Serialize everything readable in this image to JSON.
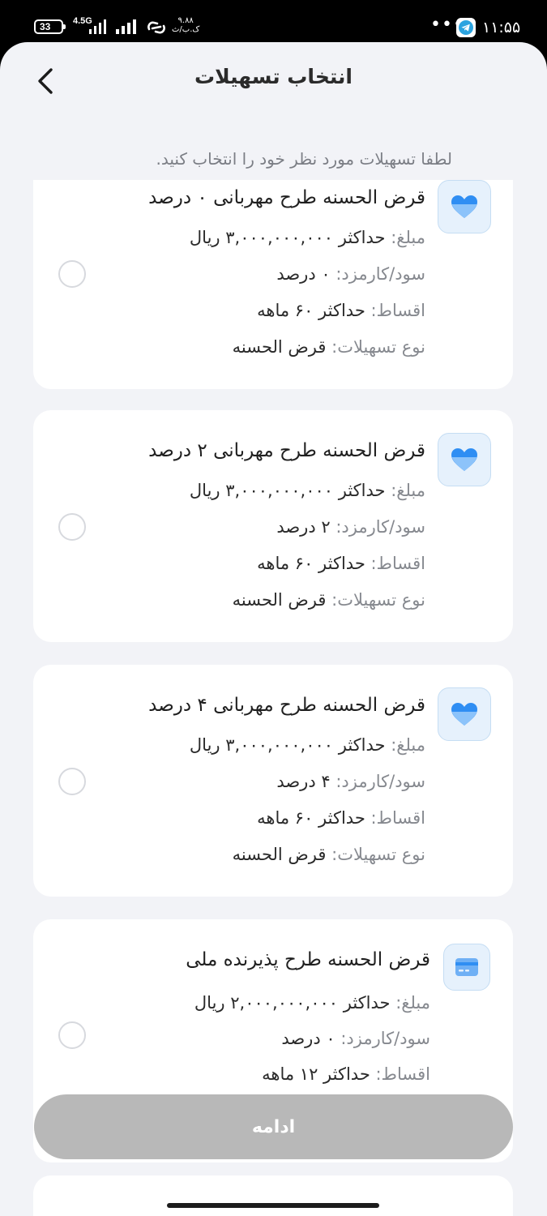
{
  "status_bar": {
    "battery": "33",
    "network": "4.5G",
    "speed_value": "۹.۸۸",
    "speed_unit": "ک.ب/ث",
    "dots": "•••",
    "time": "۱۱:۵۵",
    "icons": [
      "battery-icon",
      "signal-icon",
      "link-icon",
      "telegram-icon"
    ]
  },
  "header": {
    "title": "انتخاب تسهیلات",
    "back_icon": "chevron-left-icon"
  },
  "subtitle": "لطفا تسهیلات مورد نظر خود را انتخاب کنید.",
  "labels": {
    "amount": "مبلغ:",
    "interest": "سود/کارمزد:",
    "installments": "اقساط:",
    "type": "نوع تسهیلات:"
  },
  "cards": [
    {
      "title": "قرض الحسنه طرح مهربانی ۰ درصد",
      "icon": "heart-icon",
      "amount": "حداکثر ۳,۰۰۰,۰۰۰,۰۰۰ ریال",
      "interest": "۰ درصد",
      "installments": "حداکثر ۶۰ ماهه",
      "type": "قرض الحسنه",
      "selected": false
    },
    {
      "title": "قرض الحسنه طرح مهربانی ۲ درصد",
      "icon": "heart-icon",
      "amount": "حداکثر ۳,۰۰۰,۰۰۰,۰۰۰ ریال",
      "interest": "۲ درصد",
      "installments": "حداکثر ۶۰ ماهه",
      "type": "قرض الحسنه",
      "selected": false
    },
    {
      "title": "قرض الحسنه طرح مهربانی ۴ درصد",
      "icon": "heart-icon",
      "amount": "حداکثر ۳,۰۰۰,۰۰۰,۰۰۰ ریال",
      "interest": "۴ درصد",
      "installments": "حداکثر ۶۰ ماهه",
      "type": "قرض الحسنه",
      "selected": false
    },
    {
      "title": "قرض الحسنه طرح پذیرنده ملی",
      "icon": "card-icon",
      "amount": "حداکثر ۲,۰۰۰,۰۰۰,۰۰۰ ریال",
      "interest": "۰ درصد",
      "installments": "حداکثر ۱۲ ماهه",
      "selected": false
    }
  ],
  "continue_button": {
    "label": "ادامه",
    "enabled": false
  },
  "colors": {
    "accent": "#2f8ef3",
    "sheet_bg": "#f2f3f7",
    "card_bg": "#ffffff",
    "button_disabled": "#b8b8b8"
  }
}
